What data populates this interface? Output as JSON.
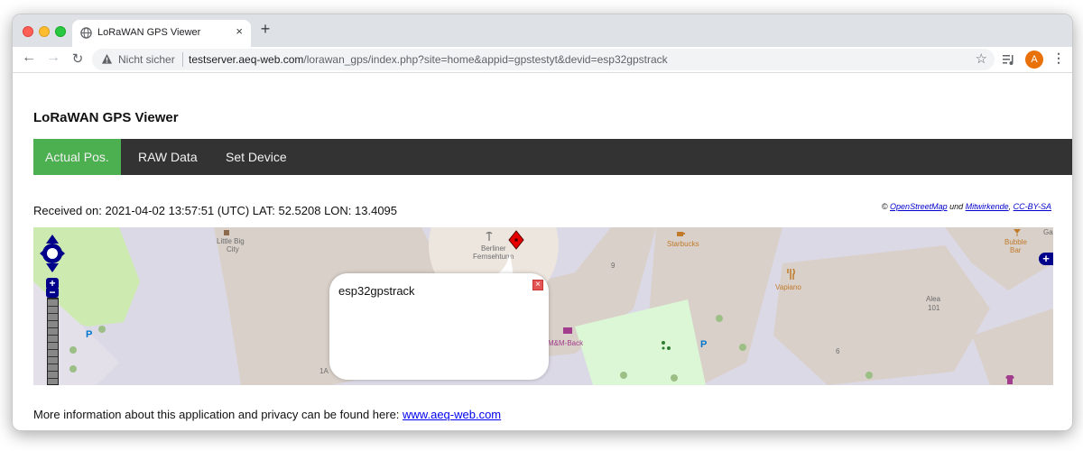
{
  "browser": {
    "tab_title": "LoRaWAN GPS Viewer",
    "tab_close": "×",
    "new_tab": "+",
    "security_label": "Nicht sicher",
    "url_host": "testserver.aeq-web.com",
    "url_path": "/lorawan_gps/index.php?site=home&appid=gpstestyt&devid=esp32gpstrack",
    "profile_initial": "A",
    "back": "←",
    "forward": "→",
    "reload": "↻",
    "star": "☆",
    "menu": "⋮"
  },
  "page": {
    "title": "LoRaWAN GPS Viewer",
    "nav": [
      {
        "label": "Actual Pos.",
        "active": true
      },
      {
        "label": "RAW Data",
        "active": false
      },
      {
        "label": "Set Device",
        "active": false
      }
    ],
    "received_text": "Received on: 2021-04-02 13:57:51 (UTC) LAT: 52.5208 LON: 13.4095",
    "attribution": {
      "prefix": "© ",
      "osm": "OpenStreetMap",
      "und": " und ",
      "contributors": "Mitwirkende",
      "comma": ", ",
      "license": "CC-BY-SA"
    },
    "footer_text": "More information about this application and privacy can be found here: ",
    "footer_link": "www.aeq-web.com"
  },
  "map": {
    "labels": {
      "little_big_city_1": "Little Big",
      "little_big_city_2": "City",
      "fernsehturm_1": "Berliner",
      "fernsehturm_2": "Fernsehturm",
      "starbucks": "Starbucks",
      "bubble_1": "Bubble",
      "bubble_2": "Bar",
      "go": "Ga",
      "nine": "9",
      "vapiano": "Vapiano",
      "alea_1": "Alea",
      "alea_2": "101",
      "six": "6",
      "mm_back": "M&M-Back",
      "onea": "1A"
    },
    "popup_text": "esp32gpstrack",
    "popup_close": "×",
    "zoom_in": "+",
    "zoom_out": "−",
    "layer_switch": "+",
    "colors": {
      "marker": "#e60000",
      "control": "#00008b",
      "park": "#cdebb0",
      "building": "#d9d0c9"
    }
  }
}
